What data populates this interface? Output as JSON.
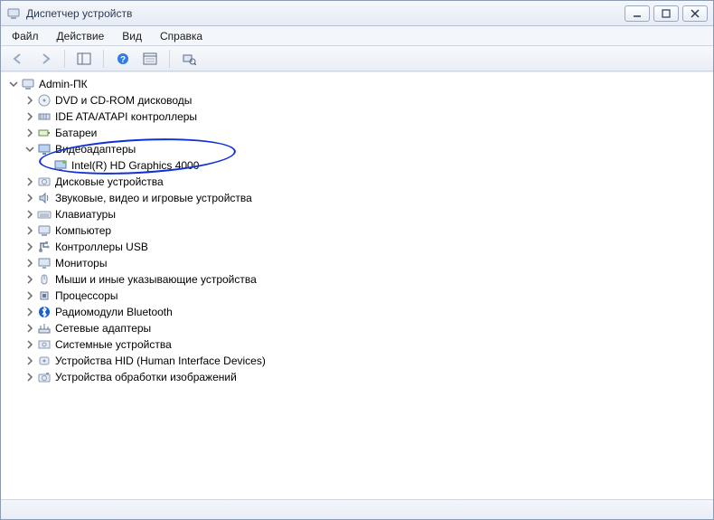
{
  "window": {
    "title": "Диспетчер устройств"
  },
  "menu": {
    "file": "Файл",
    "action": "Действие",
    "view": "Вид",
    "help": "Справка"
  },
  "tree": {
    "root": "Admin-ПК",
    "items": [
      {
        "label": "DVD и CD-ROM дисководы"
      },
      {
        "label": "IDE ATA/ATAPI контроллеры"
      },
      {
        "label": "Батареи"
      },
      {
        "label": "Видеоадаптеры",
        "expanded": true,
        "children": [
          {
            "label": "Intel(R) HD Graphics 4000"
          }
        ]
      },
      {
        "label": "Дисковые устройства"
      },
      {
        "label": "Звуковые, видео и игровые устройства"
      },
      {
        "label": "Клавиатуры"
      },
      {
        "label": "Компьютер"
      },
      {
        "label": "Контроллеры USB"
      },
      {
        "label": "Мониторы"
      },
      {
        "label": "Мыши и иные указывающие устройства"
      },
      {
        "label": "Процессоры"
      },
      {
        "label": "Радиомодули Bluetooth"
      },
      {
        "label": "Сетевые адаптеры"
      },
      {
        "label": "Системные устройства"
      },
      {
        "label": "Устройства HID (Human Interface Devices)"
      },
      {
        "label": "Устройства обработки изображений"
      }
    ]
  },
  "icons": {
    "root": "computer",
    "categories": [
      "disc",
      "ide",
      "battery",
      "display",
      "hdd",
      "sound",
      "keyboard",
      "computer",
      "usb",
      "monitor",
      "mouse",
      "cpu",
      "bluetooth",
      "network",
      "system",
      "hid",
      "imaging"
    ],
    "leaf": "display-device"
  }
}
